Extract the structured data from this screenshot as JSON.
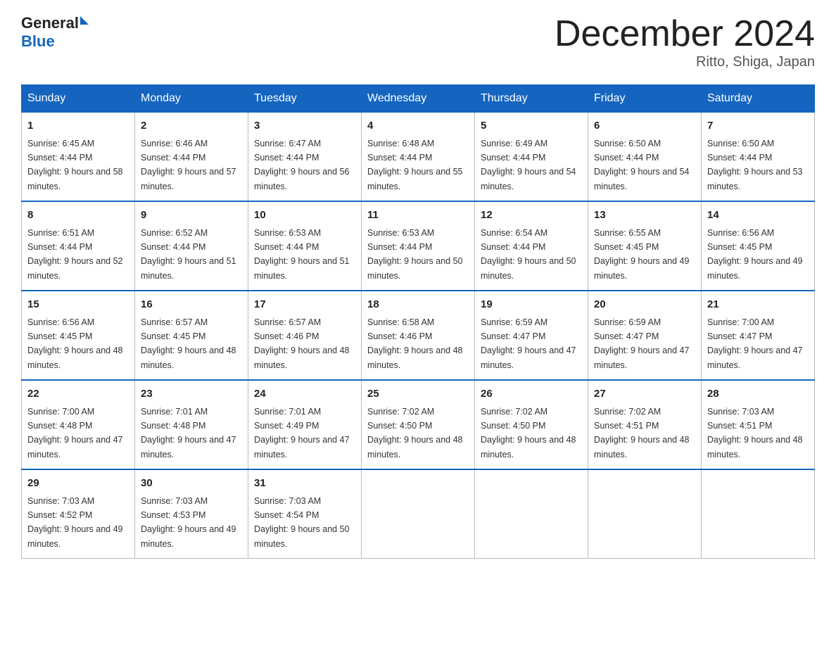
{
  "header": {
    "logo_general": "General",
    "logo_blue": "Blue",
    "month_title": "December 2024",
    "location": "Ritto, Shiga, Japan"
  },
  "weekdays": [
    "Sunday",
    "Monday",
    "Tuesday",
    "Wednesday",
    "Thursday",
    "Friday",
    "Saturday"
  ],
  "weeks": [
    [
      {
        "day": "1",
        "sunrise": "6:45 AM",
        "sunset": "4:44 PM",
        "daylight": "9 hours and 58 minutes."
      },
      {
        "day": "2",
        "sunrise": "6:46 AM",
        "sunset": "4:44 PM",
        "daylight": "9 hours and 57 minutes."
      },
      {
        "day": "3",
        "sunrise": "6:47 AM",
        "sunset": "4:44 PM",
        "daylight": "9 hours and 56 minutes."
      },
      {
        "day": "4",
        "sunrise": "6:48 AM",
        "sunset": "4:44 PM",
        "daylight": "9 hours and 55 minutes."
      },
      {
        "day": "5",
        "sunrise": "6:49 AM",
        "sunset": "4:44 PM",
        "daylight": "9 hours and 54 minutes."
      },
      {
        "day": "6",
        "sunrise": "6:50 AM",
        "sunset": "4:44 PM",
        "daylight": "9 hours and 54 minutes."
      },
      {
        "day": "7",
        "sunrise": "6:50 AM",
        "sunset": "4:44 PM",
        "daylight": "9 hours and 53 minutes."
      }
    ],
    [
      {
        "day": "8",
        "sunrise": "6:51 AM",
        "sunset": "4:44 PM",
        "daylight": "9 hours and 52 minutes."
      },
      {
        "day": "9",
        "sunrise": "6:52 AM",
        "sunset": "4:44 PM",
        "daylight": "9 hours and 51 minutes."
      },
      {
        "day": "10",
        "sunrise": "6:53 AM",
        "sunset": "4:44 PM",
        "daylight": "9 hours and 51 minutes."
      },
      {
        "day": "11",
        "sunrise": "6:53 AM",
        "sunset": "4:44 PM",
        "daylight": "9 hours and 50 minutes."
      },
      {
        "day": "12",
        "sunrise": "6:54 AM",
        "sunset": "4:44 PM",
        "daylight": "9 hours and 50 minutes."
      },
      {
        "day": "13",
        "sunrise": "6:55 AM",
        "sunset": "4:45 PM",
        "daylight": "9 hours and 49 minutes."
      },
      {
        "day": "14",
        "sunrise": "6:56 AM",
        "sunset": "4:45 PM",
        "daylight": "9 hours and 49 minutes."
      }
    ],
    [
      {
        "day": "15",
        "sunrise": "6:56 AM",
        "sunset": "4:45 PM",
        "daylight": "9 hours and 48 minutes."
      },
      {
        "day": "16",
        "sunrise": "6:57 AM",
        "sunset": "4:45 PM",
        "daylight": "9 hours and 48 minutes."
      },
      {
        "day": "17",
        "sunrise": "6:57 AM",
        "sunset": "4:46 PM",
        "daylight": "9 hours and 48 minutes."
      },
      {
        "day": "18",
        "sunrise": "6:58 AM",
        "sunset": "4:46 PM",
        "daylight": "9 hours and 48 minutes."
      },
      {
        "day": "19",
        "sunrise": "6:59 AM",
        "sunset": "4:47 PM",
        "daylight": "9 hours and 47 minutes."
      },
      {
        "day": "20",
        "sunrise": "6:59 AM",
        "sunset": "4:47 PM",
        "daylight": "9 hours and 47 minutes."
      },
      {
        "day": "21",
        "sunrise": "7:00 AM",
        "sunset": "4:47 PM",
        "daylight": "9 hours and 47 minutes."
      }
    ],
    [
      {
        "day": "22",
        "sunrise": "7:00 AM",
        "sunset": "4:48 PM",
        "daylight": "9 hours and 47 minutes."
      },
      {
        "day": "23",
        "sunrise": "7:01 AM",
        "sunset": "4:48 PM",
        "daylight": "9 hours and 47 minutes."
      },
      {
        "day": "24",
        "sunrise": "7:01 AM",
        "sunset": "4:49 PM",
        "daylight": "9 hours and 47 minutes."
      },
      {
        "day": "25",
        "sunrise": "7:02 AM",
        "sunset": "4:50 PM",
        "daylight": "9 hours and 48 minutes."
      },
      {
        "day": "26",
        "sunrise": "7:02 AM",
        "sunset": "4:50 PM",
        "daylight": "9 hours and 48 minutes."
      },
      {
        "day": "27",
        "sunrise": "7:02 AM",
        "sunset": "4:51 PM",
        "daylight": "9 hours and 48 minutes."
      },
      {
        "day": "28",
        "sunrise": "7:03 AM",
        "sunset": "4:51 PM",
        "daylight": "9 hours and 48 minutes."
      }
    ],
    [
      {
        "day": "29",
        "sunrise": "7:03 AM",
        "sunset": "4:52 PM",
        "daylight": "9 hours and 49 minutes."
      },
      {
        "day": "30",
        "sunrise": "7:03 AM",
        "sunset": "4:53 PM",
        "daylight": "9 hours and 49 minutes."
      },
      {
        "day": "31",
        "sunrise": "7:03 AM",
        "sunset": "4:54 PM",
        "daylight": "9 hours and 50 minutes."
      },
      null,
      null,
      null,
      null
    ]
  ]
}
